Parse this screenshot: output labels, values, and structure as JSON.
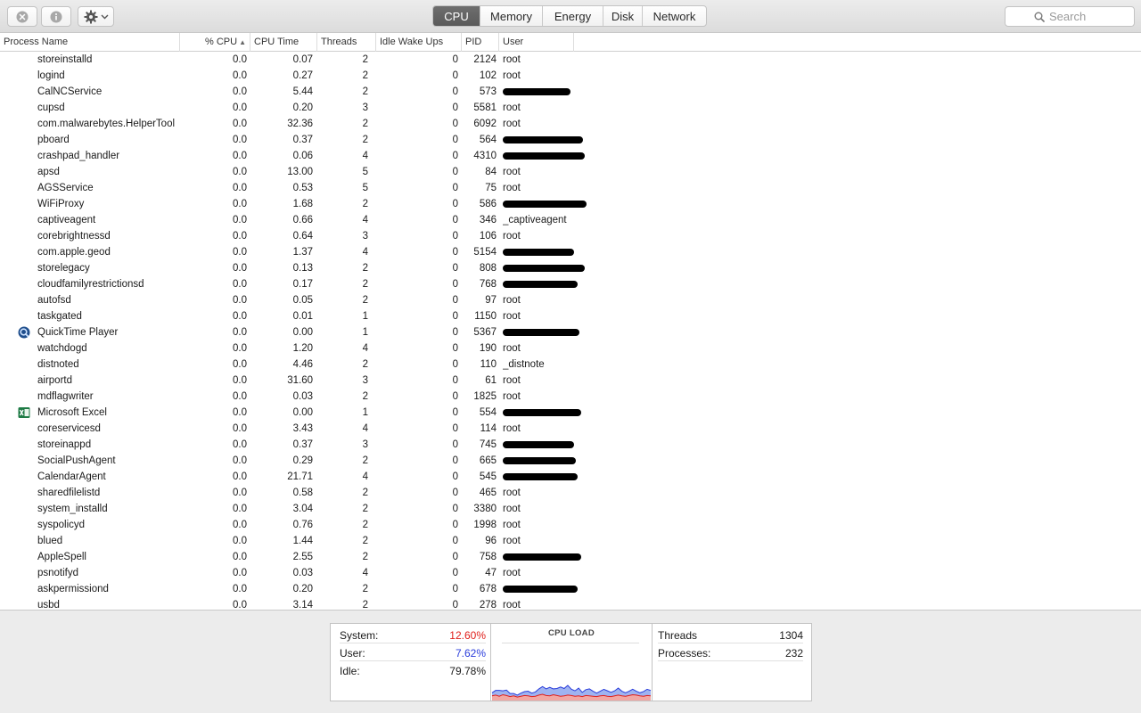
{
  "toolbar": {
    "close_icon": "close-circle-icon",
    "info_icon": "info-icon",
    "gear_icon": "gear-icon",
    "tabs": [
      {
        "label": "CPU",
        "active": true
      },
      {
        "label": "Memory",
        "active": false
      },
      {
        "label": "Energy",
        "active": false
      },
      {
        "label": "Disk",
        "active": false
      },
      {
        "label": "Network",
        "active": false
      }
    ],
    "search_placeholder": "Search"
  },
  "table": {
    "columns": {
      "process_name": "Process Name",
      "cpu": "% CPU",
      "cpu_time": "CPU Time",
      "threads": "Threads",
      "idle_wake_ups": "Idle Wake Ups",
      "pid": "PID",
      "user": "User"
    },
    "sort_column": "% CPU",
    "rows": [
      {
        "name": "storeinstalld",
        "cpu": "0.0",
        "time": "0.07",
        "threads": "2",
        "wake": "0",
        "pid": "2124",
        "user": "root"
      },
      {
        "name": "logind",
        "cpu": "0.0",
        "time": "0.27",
        "threads": "2",
        "wake": "0",
        "pid": "102",
        "user": "root"
      },
      {
        "name": "CalNCService",
        "cpu": "0.0",
        "time": "5.44",
        "threads": "2",
        "wake": "0",
        "pid": "573",
        "user": "",
        "redacted": true
      },
      {
        "name": "cupsd",
        "cpu": "0.0",
        "time": "0.20",
        "threads": "3",
        "wake": "0",
        "pid": "5581",
        "user": "root"
      },
      {
        "name": "com.malwarebytes.HelperTool",
        "cpu": "0.0",
        "time": "32.36",
        "threads": "2",
        "wake": "0",
        "pid": "6092",
        "user": "root"
      },
      {
        "name": "pboard",
        "cpu": "0.0",
        "time": "0.37",
        "threads": "2",
        "wake": "0",
        "pid": "564",
        "user": "",
        "redacted": true
      },
      {
        "name": "crashpad_handler",
        "cpu": "0.0",
        "time": "0.06",
        "threads": "4",
        "wake": "0",
        "pid": "4310",
        "user": "",
        "redacted": true
      },
      {
        "name": "apsd",
        "cpu": "0.0",
        "time": "13.00",
        "threads": "5",
        "wake": "0",
        "pid": "84",
        "user": "root"
      },
      {
        "name": "AGSService",
        "cpu": "0.0",
        "time": "0.53",
        "threads": "5",
        "wake": "0",
        "pid": "75",
        "user": "root"
      },
      {
        "name": "WiFiProxy",
        "cpu": "0.0",
        "time": "1.68",
        "threads": "2",
        "wake": "0",
        "pid": "586",
        "user": "",
        "redacted": true
      },
      {
        "name": "captiveagent",
        "cpu": "0.0",
        "time": "0.66",
        "threads": "4",
        "wake": "0",
        "pid": "346",
        "user": "_captiveagent"
      },
      {
        "name": "corebrightnessd",
        "cpu": "0.0",
        "time": "0.64",
        "threads": "3",
        "wake": "0",
        "pid": "106",
        "user": "root"
      },
      {
        "name": "com.apple.geod",
        "cpu": "0.0",
        "time": "1.37",
        "threads": "4",
        "wake": "0",
        "pid": "5154",
        "user": "",
        "redacted": true
      },
      {
        "name": "storelegacy",
        "cpu": "0.0",
        "time": "0.13",
        "threads": "2",
        "wake": "0",
        "pid": "808",
        "user": "",
        "redacted": true
      },
      {
        "name": "cloudfamilyrestrictionsd",
        "cpu": "0.0",
        "time": "0.17",
        "threads": "2",
        "wake": "0",
        "pid": "768",
        "user": "",
        "redacted": true
      },
      {
        "name": "autofsd",
        "cpu": "0.0",
        "time": "0.05",
        "threads": "2",
        "wake": "0",
        "pid": "97",
        "user": "root"
      },
      {
        "name": "taskgated",
        "cpu": "0.0",
        "time": "0.01",
        "threads": "1",
        "wake": "0",
        "pid": "1150",
        "user": "root"
      },
      {
        "name": "QuickTime Player",
        "cpu": "0.0",
        "time": "0.00",
        "threads": "1",
        "wake": "0",
        "pid": "5367",
        "user": "",
        "redacted": true,
        "icon": "quicktime-icon"
      },
      {
        "name": "watchdogd",
        "cpu": "0.0",
        "time": "1.20",
        "threads": "4",
        "wake": "0",
        "pid": "190",
        "user": "root"
      },
      {
        "name": "distnoted",
        "cpu": "0.0",
        "time": "4.46",
        "threads": "2",
        "wake": "0",
        "pid": "110",
        "user": "_distnote"
      },
      {
        "name": "airportd",
        "cpu": "0.0",
        "time": "31.60",
        "threads": "3",
        "wake": "0",
        "pid": "61",
        "user": "root"
      },
      {
        "name": "mdflagwriter",
        "cpu": "0.0",
        "time": "0.03",
        "threads": "2",
        "wake": "0",
        "pid": "1825",
        "user": "root"
      },
      {
        "name": "Microsoft Excel",
        "cpu": "0.0",
        "time": "0.00",
        "threads": "1",
        "wake": "0",
        "pid": "554",
        "user": "",
        "redacted": true,
        "icon": "excel-icon"
      },
      {
        "name": "coreservicesd",
        "cpu": "0.0",
        "time": "3.43",
        "threads": "4",
        "wake": "0",
        "pid": "114",
        "user": "root"
      },
      {
        "name": "storeinappd",
        "cpu": "0.0",
        "time": "0.37",
        "threads": "3",
        "wake": "0",
        "pid": "745",
        "user": "",
        "redacted": true
      },
      {
        "name": "SocialPushAgent",
        "cpu": "0.0",
        "time": "0.29",
        "threads": "2",
        "wake": "0",
        "pid": "665",
        "user": "",
        "redacted": true
      },
      {
        "name": "CalendarAgent",
        "cpu": "0.0",
        "time": "21.71",
        "threads": "4",
        "wake": "0",
        "pid": "545",
        "user": "",
        "redacted": true
      },
      {
        "name": "sharedfilelistd",
        "cpu": "0.0",
        "time": "0.58",
        "threads": "2",
        "wake": "0",
        "pid": "465",
        "user": "root"
      },
      {
        "name": "system_installd",
        "cpu": "0.0",
        "time": "3.04",
        "threads": "2",
        "wake": "0",
        "pid": "3380",
        "user": "root"
      },
      {
        "name": "syspolicyd",
        "cpu": "0.0",
        "time": "0.76",
        "threads": "2",
        "wake": "0",
        "pid": "1998",
        "user": "root"
      },
      {
        "name": "blued",
        "cpu": "0.0",
        "time": "1.44",
        "threads": "2",
        "wake": "0",
        "pid": "96",
        "user": "root"
      },
      {
        "name": "AppleSpell",
        "cpu": "0.0",
        "time": "2.55",
        "threads": "2",
        "wake": "0",
        "pid": "758",
        "user": "",
        "redacted": true
      },
      {
        "name": "psnotifyd",
        "cpu": "0.0",
        "time": "0.03",
        "threads": "4",
        "wake": "0",
        "pid": "47",
        "user": "root"
      },
      {
        "name": "askpermissiond",
        "cpu": "0.0",
        "time": "0.20",
        "threads": "2",
        "wake": "0",
        "pid": "678",
        "user": "",
        "redacted": true
      },
      {
        "name": "usbd",
        "cpu": "0.0",
        "time": "3.14",
        "threads": "2",
        "wake": "0",
        "pid": "278",
        "user": "root"
      }
    ]
  },
  "stats": {
    "system_label": "System:",
    "system_value": "12.60%",
    "system_color": "#e0201c",
    "user_label": "User:",
    "user_value": "7.62%",
    "user_color": "#2a3ddb",
    "idle_label": "Idle:",
    "idle_value": "79.78%",
    "cpu_load_title": "CPU LOAD",
    "threads_label": "Threads",
    "threads_value": "1304",
    "processes_label": "Processes:",
    "processes_value": "232"
  },
  "chart_data": {
    "type": "area",
    "title": "CPU LOAD",
    "ylim": [
      0,
      100
    ],
    "series": [
      {
        "name": "System",
        "color": "#e0201c",
        "values": [
          12,
          14,
          11,
          15,
          13,
          10,
          12,
          9,
          11,
          13,
          12,
          10,
          11,
          14,
          16,
          13,
          12,
          15,
          13,
          11,
          12,
          14,
          13,
          11,
          12,
          10,
          13,
          12,
          11,
          10,
          12,
          13,
          11,
          10,
          12,
          14,
          12,
          11,
          13,
          15,
          14,
          12,
          11,
          13,
          12
        ]
      },
      {
        "name": "User",
        "color": "#2a3ddb",
        "values": [
          8,
          12,
          15,
          10,
          14,
          8,
          6,
          5,
          8,
          10,
          12,
          9,
          11,
          16,
          20,
          17,
          22,
          15,
          18,
          24,
          19,
          25,
          16,
          14,
          20,
          11,
          15,
          18,
          13,
          9,
          12,
          16,
          14,
          11,
          13,
          18,
          12,
          9,
          11,
          14,
          10,
          8,
          12,
          16,
          14
        ]
      }
    ]
  }
}
